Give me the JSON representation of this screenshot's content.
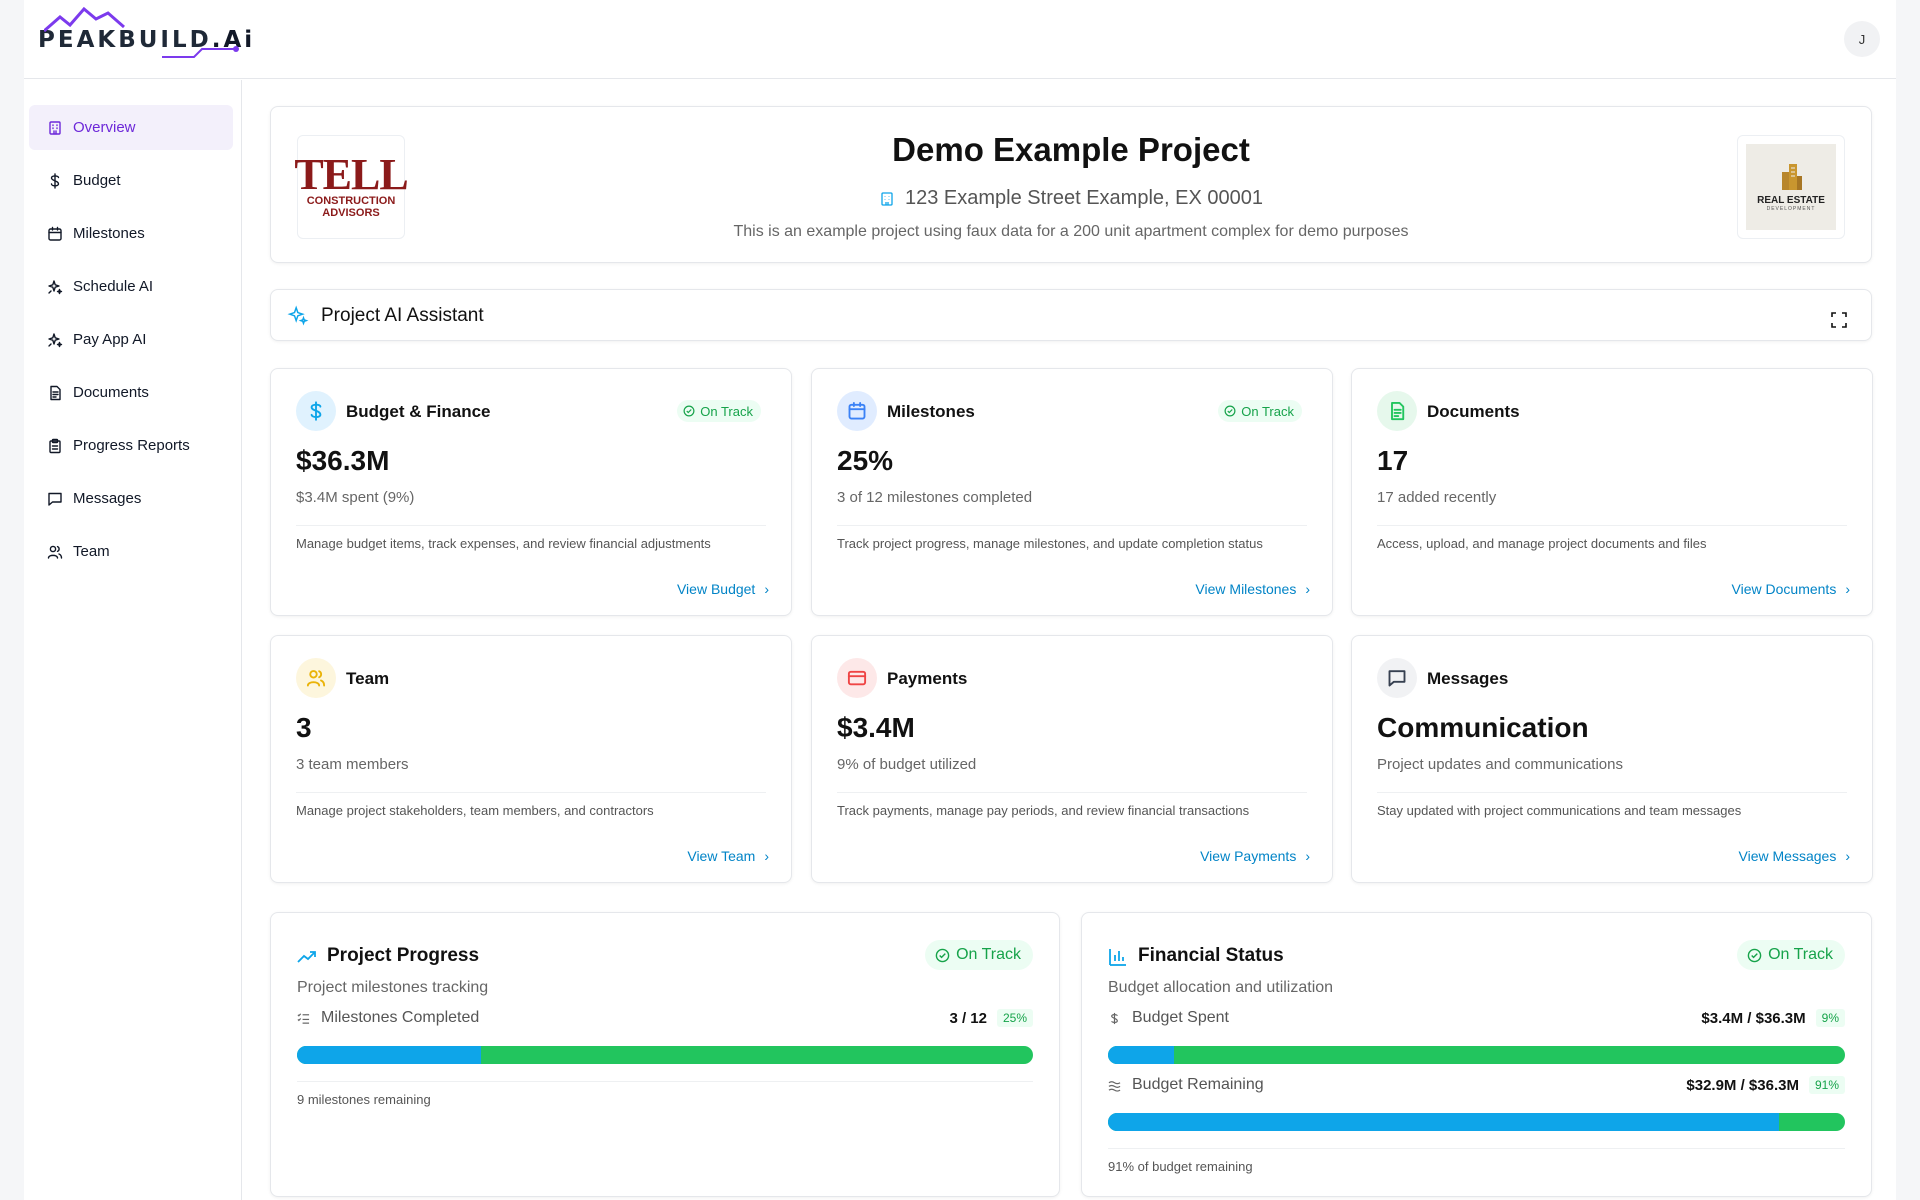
{
  "app": {
    "logo_text": "PEAKBUILD",
    "logo_suffix": ".Ai",
    "avatar_initial": "J",
    "accent": "#6d28d9"
  },
  "sidebar": {
    "items": [
      {
        "label": "Overview",
        "icon": "building-icon",
        "active": true
      },
      {
        "label": "Budget",
        "icon": "dollar-icon"
      },
      {
        "label": "Milestones",
        "icon": "calendar-icon"
      },
      {
        "label": "Schedule AI",
        "icon": "sparkles-icon"
      },
      {
        "label": "Pay App AI",
        "icon": "sparkles-icon"
      },
      {
        "label": "Documents",
        "icon": "document-icon"
      },
      {
        "label": "Progress Reports",
        "icon": "clipboard-icon"
      },
      {
        "label": "Messages",
        "icon": "message-icon"
      },
      {
        "label": "Team",
        "icon": "users-icon"
      }
    ]
  },
  "project": {
    "title": "Demo Example Project",
    "address": "123 Example Street Example, EX 00001",
    "description": "This is an example project using faux data for a 200 unit apartment complex for demo purposes",
    "client_logo": {
      "main": "TELL",
      "line1": "CONSTRUCTION",
      "line2": "ADVISORS"
    },
    "owner_logo": {
      "main": "REAL ESTATE",
      "sub": "DEVELOPMENT"
    }
  },
  "assistant": {
    "label": "Project AI Assistant"
  },
  "tiles": [
    {
      "title": "Budget & Finance",
      "badge": "On Track",
      "value": "$36.3M",
      "subtitle": "$3.4M spent (9%)",
      "description": "Manage budget items, track expenses, and review financial adjustments",
      "link": "View Budget",
      "icon": "dollar-icon",
      "icon_color": "#0ea5e9",
      "icon_bg": "#e0f2fe"
    },
    {
      "title": "Milestones",
      "badge": "On Track",
      "value": "25%",
      "subtitle": "3 of 12 milestones completed",
      "description": "Track project progress, manage milestones, and update completion status",
      "link": "View Milestones",
      "icon": "calendar-icon",
      "icon_color": "#3b82f6",
      "icon_bg": "#e0ecff"
    },
    {
      "title": "Documents",
      "badge": "",
      "value": "17",
      "subtitle": "17 added recently",
      "description": "Access, upload, and manage project documents and files",
      "link": "View Documents",
      "icon": "document-icon",
      "icon_color": "#22c55e",
      "icon_bg": "#e6f8ec"
    },
    {
      "title": "Team",
      "badge": "",
      "value": "3",
      "subtitle": "3 team members",
      "description": "Manage project stakeholders, team members, and contractors",
      "link": "View Team",
      "icon": "users-icon",
      "icon_color": "#eab308",
      "icon_bg": "#fdf6dd"
    },
    {
      "title": "Payments",
      "badge": "",
      "value": "$3.4M",
      "subtitle": "9% of budget utilized",
      "description": "Track payments, manage pay periods, and review financial transactions",
      "link": "View Payments",
      "icon": "credit-card-icon",
      "icon_color": "#ef4444",
      "icon_bg": "#fde8e8"
    },
    {
      "title": "Messages",
      "badge": "",
      "value": "Communication",
      "subtitle": "Project updates and communications",
      "description": "Stay updated with project communications and team messages",
      "link": "View Messages",
      "icon": "message-icon",
      "icon_color": "#374151",
      "icon_bg": "#f1f2f4"
    }
  ],
  "progress": {
    "title": "Project Progress",
    "badge": "On Track",
    "subtitle": "Project milestones tracking",
    "metric_label": "Milestones Completed",
    "metric_value": "3 / 12",
    "metric_pct": "25%",
    "fraction": 0.25,
    "note": "9 milestones remaining"
  },
  "financial": {
    "title": "Financial Status",
    "badge": "On Track",
    "subtitle": "Budget allocation and utilization",
    "spent_label": "Budget Spent",
    "spent_value": "$3.4M / $36.3M",
    "spent_pct": "9%",
    "spent_fraction": 0.09,
    "remaining_label": "Budget Remaining",
    "remaining_value": "$32.9M / $36.3M",
    "remaining_pct": "91%",
    "remaining_fraction": 0.91,
    "note": "91% of budget remaining"
  }
}
